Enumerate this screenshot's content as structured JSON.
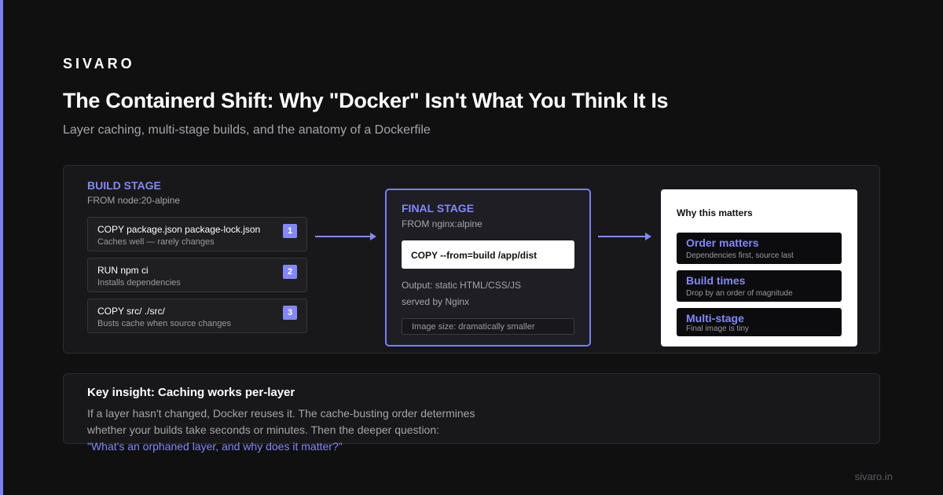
{
  "brand": "SIVARO",
  "title": "The Containerd Shift: Why \"Docker\" Isn't What You Think It Is",
  "subtitle": "Layer caching, multi-stage builds, and the anatomy of a Dockerfile",
  "build_stage": {
    "label": "BUILD STAGE",
    "from": "FROM node:20-alpine",
    "layers": [
      {
        "command": "COPY package.json package-lock.json",
        "note": "Caches well — rarely changes",
        "number": "1"
      },
      {
        "command": "RUN npm ci",
        "note": "Installs dependencies",
        "number": "2"
      },
      {
        "command": "COPY src/ ./src/",
        "note": "Busts cache when source changes",
        "number": "3"
      }
    ]
  },
  "final_stage": {
    "label": "FINAL STAGE",
    "from": "FROM nginx:alpine",
    "copy_command": "COPY --from=build /app/dist",
    "output_line1": "Output: static HTML/CSS/JS",
    "output_line2": "served by Nginx",
    "image_size": "Image size: dramatically smaller"
  },
  "why": {
    "title": "Why this matters",
    "items": [
      {
        "heading": "Order matters",
        "detail": "Dependencies first, source last"
      },
      {
        "heading": "Build times",
        "detail": "Drop by an order of magnitude"
      },
      {
        "heading": "Multi-stage",
        "detail": "Final image is tiny"
      }
    ]
  },
  "insight": {
    "title": "Key insight: Caching works per-layer",
    "line1": "If a layer hasn't changed, Docker reuses it. The cache-busting order determines",
    "line2": "whether your builds take seconds or minutes. Then the deeper question:",
    "quote": "\"What's an orphaned layer, and why does it matter?\""
  },
  "footer": "sivaro.in",
  "colors": {
    "accent": "#7b7ff0",
    "background": "#101011",
    "panel": "#18181a"
  }
}
